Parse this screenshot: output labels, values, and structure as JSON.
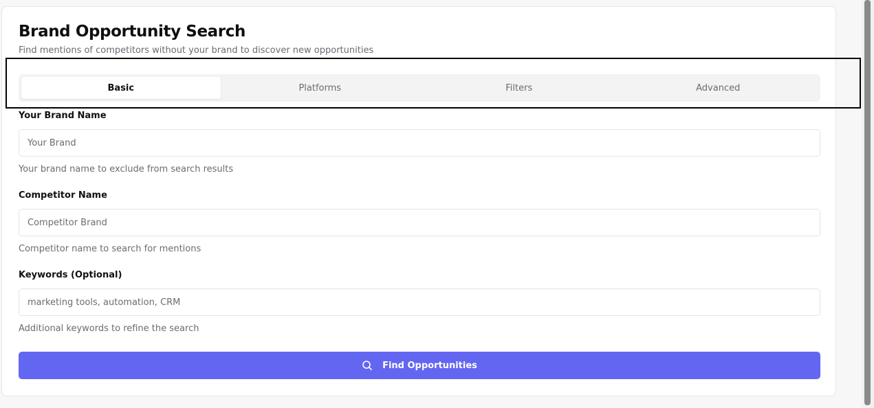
{
  "page": {
    "title": "Brand Opportunity Search",
    "subtitle": "Find mentions of competitors without your brand to discover new opportunities"
  },
  "tabs": [
    {
      "label": "Basic",
      "active": true
    },
    {
      "label": "Platforms",
      "active": false
    },
    {
      "label": "Filters",
      "active": false
    },
    {
      "label": "Advanced",
      "active": false
    }
  ],
  "form": {
    "brand": {
      "label": "Your Brand Name",
      "placeholder": "Your Brand",
      "value": "",
      "hint": "Your brand name to exclude from search results"
    },
    "competitor": {
      "label": "Competitor Name",
      "placeholder": "Competitor Brand",
      "value": "",
      "hint": "Competitor name to search for mentions"
    },
    "keywords": {
      "label": "Keywords (Optional)",
      "placeholder": "marketing tools, automation, CRM",
      "value": "",
      "hint": "Additional keywords to refine the search"
    },
    "submit": {
      "label": "Find Opportunities",
      "icon": "search-icon"
    }
  },
  "colors": {
    "accent": "#6366f1",
    "muted_text": "#6b6b73",
    "tab_bg": "#f3f3f4"
  }
}
